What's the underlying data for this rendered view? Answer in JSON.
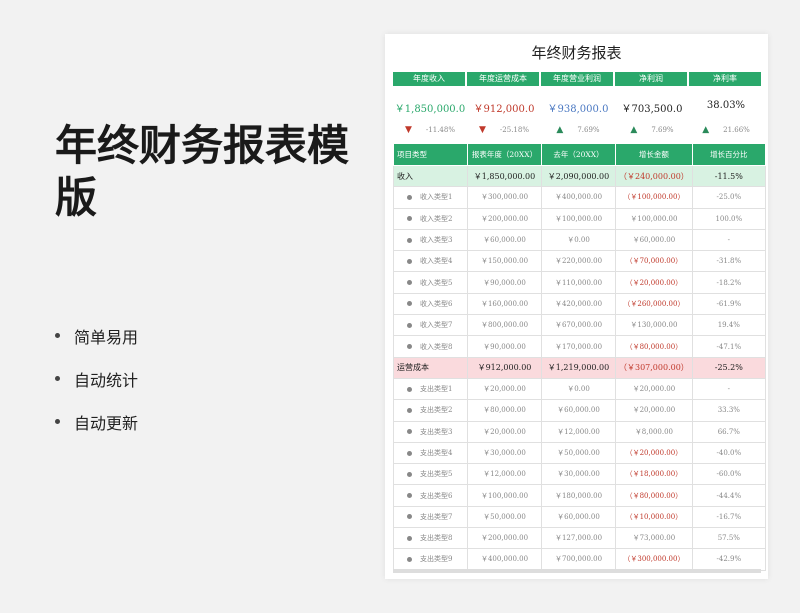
{
  "promo": {
    "title": "年终财务报表模版",
    "bullets": [
      "简单易用",
      "自动统计",
      "自动更新"
    ]
  },
  "sheet": {
    "title": "年终财务报表",
    "kpis": [
      {
        "label": "年度收入",
        "value": "￥1,850,000.0",
        "trend": "-11.48%",
        "dir": "down",
        "color": "#2aa86b"
      },
      {
        "label": "年度运营成本",
        "value": "￥912,000.0",
        "trend": "-25.18%",
        "dir": "down",
        "color": "#c0392b"
      },
      {
        "label": "年度营业利润",
        "value": "￥938,000.0",
        "trend": "7.69%",
        "dir": "up",
        "color": "#4a78c2"
      },
      {
        "label": "净利润",
        "value": "￥703,500.0",
        "trend": "7.69%",
        "dir": "up",
        "color": "#222222"
      },
      {
        "label": "净利率",
        "value": "38.03%",
        "trend": "21.66%",
        "dir": "up",
        "color": "#222222"
      }
    ],
    "columns": [
      "项目类型",
      "报表年度（20XX）",
      "去年（20XX）",
      "增长金额",
      "增长百分比"
    ],
    "rows": [
      {
        "kind": "sum-in",
        "name": "收入",
        "a": "￥1,850,000.00",
        "b": "￥2,090,000.00",
        "c": "（￥240,000.00）",
        "d": "-11.5%",
        "neg": true
      },
      {
        "kind": "item",
        "name": "收入类型1",
        "a": "￥300,000.00",
        "b": "￥400,000.00",
        "c": "（￥100,000.00）",
        "d": "-25.0%",
        "neg": true
      },
      {
        "kind": "item",
        "name": "收入类型2",
        "a": "￥200,000.00",
        "b": "￥100,000.00",
        "c": "￥100,000.00",
        "d": "100.0%",
        "neg": false
      },
      {
        "kind": "item",
        "name": "收入类型3",
        "a": "￥60,000.00",
        "b": "￥0.00",
        "c": "￥60,000.00",
        "d": "-",
        "neg": false
      },
      {
        "kind": "item",
        "name": "收入类型4",
        "a": "￥150,000.00",
        "b": "￥220,000.00",
        "c": "（￥70,000.00）",
        "d": "-31.8%",
        "neg": true
      },
      {
        "kind": "item",
        "name": "收入类型5",
        "a": "￥90,000.00",
        "b": "￥110,000.00",
        "c": "（￥20,000.00）",
        "d": "-18.2%",
        "neg": true
      },
      {
        "kind": "item",
        "name": "收入类型6",
        "a": "￥160,000.00",
        "b": "￥420,000.00",
        "c": "（￥260,000.00）",
        "d": "-61.9%",
        "neg": true
      },
      {
        "kind": "item",
        "name": "收入类型7",
        "a": "￥800,000.00",
        "b": "￥670,000.00",
        "c": "￥130,000.00",
        "d": "19.4%",
        "neg": false
      },
      {
        "kind": "item",
        "name": "收入类型8",
        "a": "￥90,000.00",
        "b": "￥170,000.00",
        "c": "（￥80,000.00）",
        "d": "-47.1%",
        "neg": true
      },
      {
        "kind": "sum-cost",
        "name": "运营成本",
        "a": "￥912,000.00",
        "b": "￥1,219,000.00",
        "c": "（￥307,000.00）",
        "d": "-25.2%",
        "neg": true
      },
      {
        "kind": "item",
        "name": "支出类型1",
        "a": "￥20,000.00",
        "b": "￥0.00",
        "c": "￥20,000.00",
        "d": "-",
        "neg": false
      },
      {
        "kind": "item",
        "name": "支出类型2",
        "a": "￥80,000.00",
        "b": "￥60,000.00",
        "c": "￥20,000.00",
        "d": "33.3%",
        "neg": false
      },
      {
        "kind": "item",
        "name": "支出类型3",
        "a": "￥20,000.00",
        "b": "￥12,000.00",
        "c": "￥8,000.00",
        "d": "66.7%",
        "neg": false
      },
      {
        "kind": "item",
        "name": "支出类型4",
        "a": "￥30,000.00",
        "b": "￥50,000.00",
        "c": "（￥20,000.00）",
        "d": "-40.0%",
        "neg": true
      },
      {
        "kind": "item",
        "name": "支出类型5",
        "a": "￥12,000.00",
        "b": "￥30,000.00",
        "c": "（￥18,000.00）",
        "d": "-60.0%",
        "neg": true
      },
      {
        "kind": "item",
        "name": "支出类型6",
        "a": "￥100,000.00",
        "b": "￥180,000.00",
        "c": "（￥80,000.00）",
        "d": "-44.4%",
        "neg": true
      },
      {
        "kind": "item",
        "name": "支出类型7",
        "a": "￥50,000.00",
        "b": "￥60,000.00",
        "c": "（￥10,000.00）",
        "d": "-16.7%",
        "neg": true
      },
      {
        "kind": "item",
        "name": "支出类型8",
        "a": "￥200,000.00",
        "b": "￥127,000.00",
        "c": "￥73,000.00",
        "d": "57.5%",
        "neg": false
      },
      {
        "kind": "item",
        "name": "支出类型9",
        "a": "￥400,000.00",
        "b": "￥700,000.00",
        "c": "（￥300,000.00）",
        "d": "-42.9%",
        "neg": true
      }
    ]
  }
}
